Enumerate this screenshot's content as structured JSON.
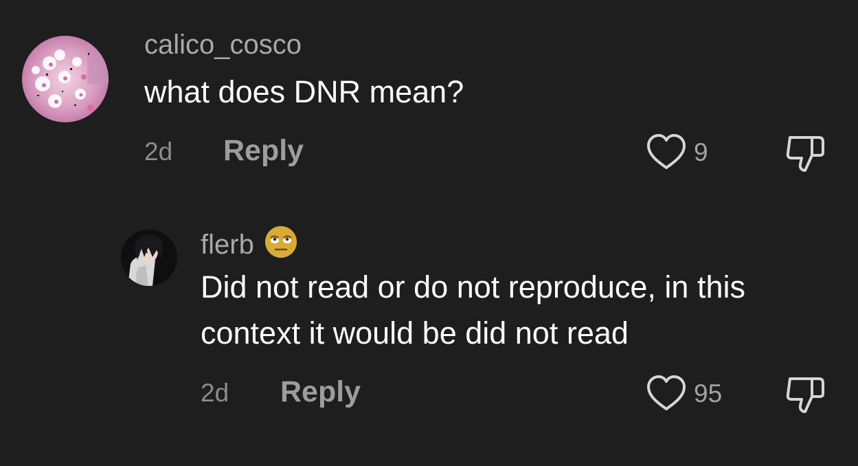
{
  "comments": [
    {
      "username": "calico_cosco",
      "text": "what does DNR mean?",
      "age": "2d",
      "reply_label": "Reply",
      "likes": "9",
      "avatar_icon": "pink-blossom-avatar"
    },
    {
      "username": "flerb",
      "username_emoji": "face-with-rolling-eyes-emoji",
      "text": "Did not read or do not reproduce, in this context it would be did not read",
      "age": "2d",
      "reply_label": "Reply",
      "likes": "95",
      "avatar_icon": "anime-character-avatar"
    }
  ],
  "colors": {
    "background": "#1e1e1e",
    "username": "#a9a9a9",
    "text": "#ffffff",
    "meta": "#8c8c8c",
    "icon": "#d6d6d6"
  }
}
